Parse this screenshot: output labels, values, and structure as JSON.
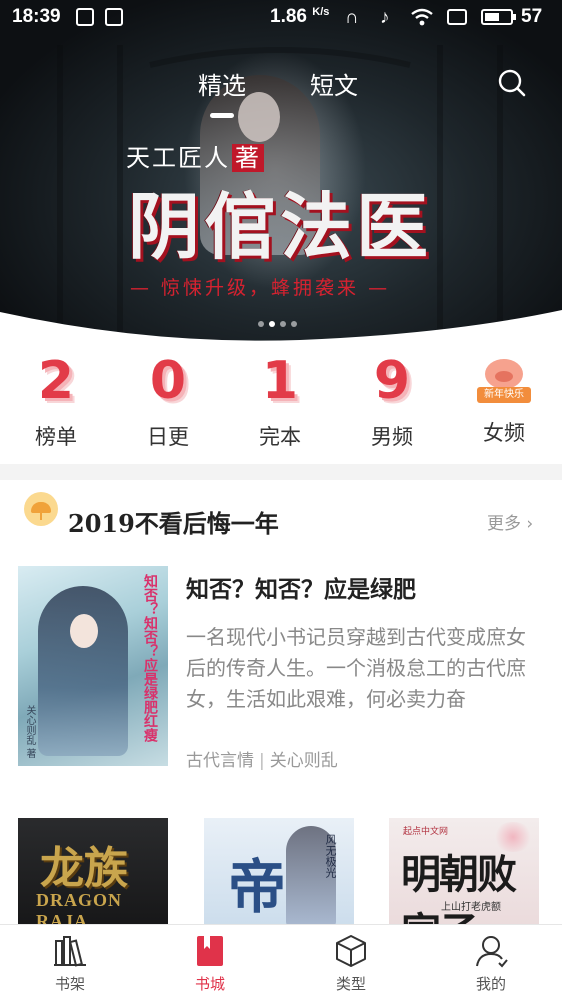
{
  "status_bar": {
    "time": "18:39",
    "speed": "1.86",
    "speed_unit": "K/s",
    "battery": "57",
    "battery_level": 0.57
  },
  "header": {
    "tabs": [
      {
        "label": "精选",
        "active": true
      },
      {
        "label": "短文",
        "active": false
      }
    ],
    "search_icon": "search-icon"
  },
  "banner": {
    "author": "天工匠人",
    "author_stamp": "著",
    "title": "阴倌法医",
    "tagline": "— 惊悚升级，蜂拥袭来 —",
    "dots": 4,
    "active_dot": 1
  },
  "quick_nav": [
    {
      "glyph": "2",
      "label": "榜单"
    },
    {
      "glyph": "0",
      "label": "日更"
    },
    {
      "glyph": "1",
      "label": "完本"
    },
    {
      "glyph": "9",
      "label": "男频"
    },
    {
      "glyph": "",
      "label": "女频",
      "badge": "新年快乐"
    }
  ],
  "section": {
    "title": "2019不看后悔一年",
    "more_label": "更多",
    "featured": {
      "title": "知否？知否？应是绿肥",
      "description": "一名现代小书记员穿越到古代变成庶女后的传奇人生。一个消极怠工的古代庶女，生活如此艰难，何必卖力奋",
      "genre": "古代言情",
      "author": "关心则乱",
      "cover_title": "知否？知否？应是绿肥红瘦",
      "cover_author": "关心则乱 著"
    },
    "books": [
      {
        "cover_title": "龙族",
        "cover_subtitle": "DRAGON RAJA"
      },
      {
        "cover_title": "帝",
        "cover_subtitle": "风无极光"
      },
      {
        "cover_title": "明朝败家子",
        "cover_publisher": "起点中文网",
        "cover_author": "上山打老虎额"
      }
    ]
  },
  "bottom_nav": [
    {
      "label": "书架",
      "icon": "bookshelf-icon",
      "active": false
    },
    {
      "label": "书城",
      "icon": "bookstore-icon",
      "active": true
    },
    {
      "label": "类型",
      "icon": "category-cube-icon",
      "active": false
    },
    {
      "label": "我的",
      "icon": "profile-icon",
      "active": false
    }
  ],
  "colors": {
    "accent": "#e0334a",
    "quick_glyph": "#e23b48",
    "more_text": "#999999"
  }
}
